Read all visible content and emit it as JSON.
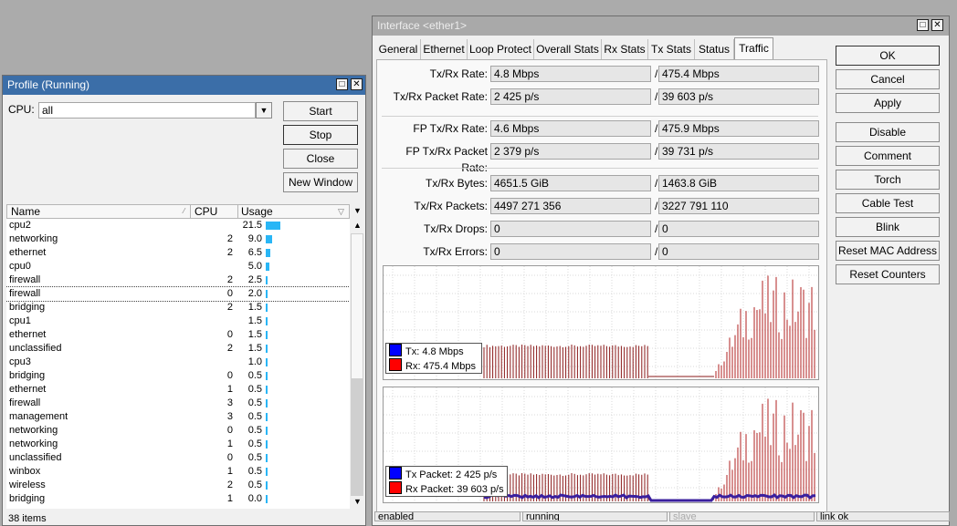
{
  "profile": {
    "title": "Profile (Running)",
    "cpu_label": "CPU:",
    "cpu_value": "all",
    "buttons": {
      "start": "Start",
      "stop": "Stop",
      "close": "Close",
      "new_window": "New Window"
    },
    "columns": {
      "name": "Name",
      "cpu": "CPU",
      "usage": "Usage"
    },
    "rows": [
      {
        "name": "cpu2",
        "cpu": "",
        "usage": "21.5",
        "level": 21.5
      },
      {
        "name": "networking",
        "cpu": "2",
        "usage": "9.0",
        "level": 9.0
      },
      {
        "name": "ethernet",
        "cpu": "2",
        "usage": "6.5",
        "level": 6.5
      },
      {
        "name": "cpu0",
        "cpu": "",
        "usage": "5.0",
        "level": 5.0
      },
      {
        "name": "firewall",
        "cpu": "2",
        "usage": "2.5",
        "level": 2.5
      },
      {
        "name": "firewall",
        "cpu": "0",
        "usage": "2.0",
        "level": 2.0
      },
      {
        "name": "bridging",
        "cpu": "2",
        "usage": "1.5",
        "level": 1.5
      },
      {
        "name": "cpu1",
        "cpu": "",
        "usage": "1.5",
        "level": 1.5
      },
      {
        "name": "ethernet",
        "cpu": "0",
        "usage": "1.5",
        "level": 1.5
      },
      {
        "name": "unclassified",
        "cpu": "2",
        "usage": "1.5",
        "level": 1.5
      },
      {
        "name": "cpu3",
        "cpu": "",
        "usage": "1.0",
        "level": 1.0
      },
      {
        "name": "bridging",
        "cpu": "0",
        "usage": "0.5",
        "level": 0.5
      },
      {
        "name": "ethernet",
        "cpu": "1",
        "usage": "0.5",
        "level": 0.5
      },
      {
        "name": "firewall",
        "cpu": "3",
        "usage": "0.5",
        "level": 0.5
      },
      {
        "name": "management",
        "cpu": "3",
        "usage": "0.5",
        "level": 0.5
      },
      {
        "name": "networking",
        "cpu": "0",
        "usage": "0.5",
        "level": 0.5
      },
      {
        "name": "networking",
        "cpu": "1",
        "usage": "0.5",
        "level": 0.5
      },
      {
        "name": "unclassified",
        "cpu": "0",
        "usage": "0.5",
        "level": 0.5
      },
      {
        "name": "winbox",
        "cpu": "1",
        "usage": "0.5",
        "level": 0.5
      },
      {
        "name": "wireless",
        "cpu": "2",
        "usage": "0.5",
        "level": 0.5
      },
      {
        "name": "bridging",
        "cpu": "1",
        "usage": "0.0",
        "level": 0.0
      }
    ],
    "footer": "38 items"
  },
  "iface": {
    "title": "Interface <ether1>",
    "tabs": [
      "General",
      "Ethernet",
      "Loop Protect",
      "Overall Stats",
      "Rx Stats",
      "Tx Stats",
      "Status",
      "Traffic"
    ],
    "active_tab": "Traffic",
    "stats": [
      {
        "label": "Tx/Rx Rate:",
        "tx": "4.8 Mbps",
        "rx": "475.4 Mbps"
      },
      {
        "label": "Tx/Rx Packet Rate:",
        "tx": "2 425 p/s",
        "rx": "39 603 p/s"
      },
      {
        "label": "FP Tx/Rx Rate:",
        "tx": "4.6 Mbps",
        "rx": "475.9 Mbps"
      },
      {
        "label": "FP Tx/Rx Packet Rate:",
        "tx": "2 379 p/s",
        "rx": "39 731 p/s"
      },
      {
        "label": "Tx/Rx Bytes:",
        "tx": "4651.5 GiB",
        "rx": "1463.8 GiB"
      },
      {
        "label": "Tx/Rx Packets:",
        "tx": "4497 271 356",
        "rx": "3227 791 110"
      },
      {
        "label": "Tx/Rx Drops:",
        "tx": "0",
        "rx": "0"
      },
      {
        "label": "Tx/Rx Errors:",
        "tx": "0",
        "rx": "0"
      }
    ],
    "buttons": [
      "OK",
      "Cancel",
      "Apply",
      "Disable",
      "Comment",
      "Torch",
      "Cable Test",
      "Blink",
      "Reset MAC Address",
      "Reset Counters"
    ],
    "legend_traffic": {
      "tx": "Tx:  4.8 Mbps",
      "rx": "Rx:  475.4 Mbps"
    },
    "legend_packets": {
      "tx": "Tx Packet:  2 425 p/s",
      "rx": "Rx Packet:  39 603 p/s"
    },
    "colors": {
      "tx": "#0000ff",
      "rx": "#ff0000",
      "rx_line": "#8b1a1a"
    },
    "status_bar": [
      "enabled",
      "running",
      "slave",
      "link ok"
    ]
  }
}
